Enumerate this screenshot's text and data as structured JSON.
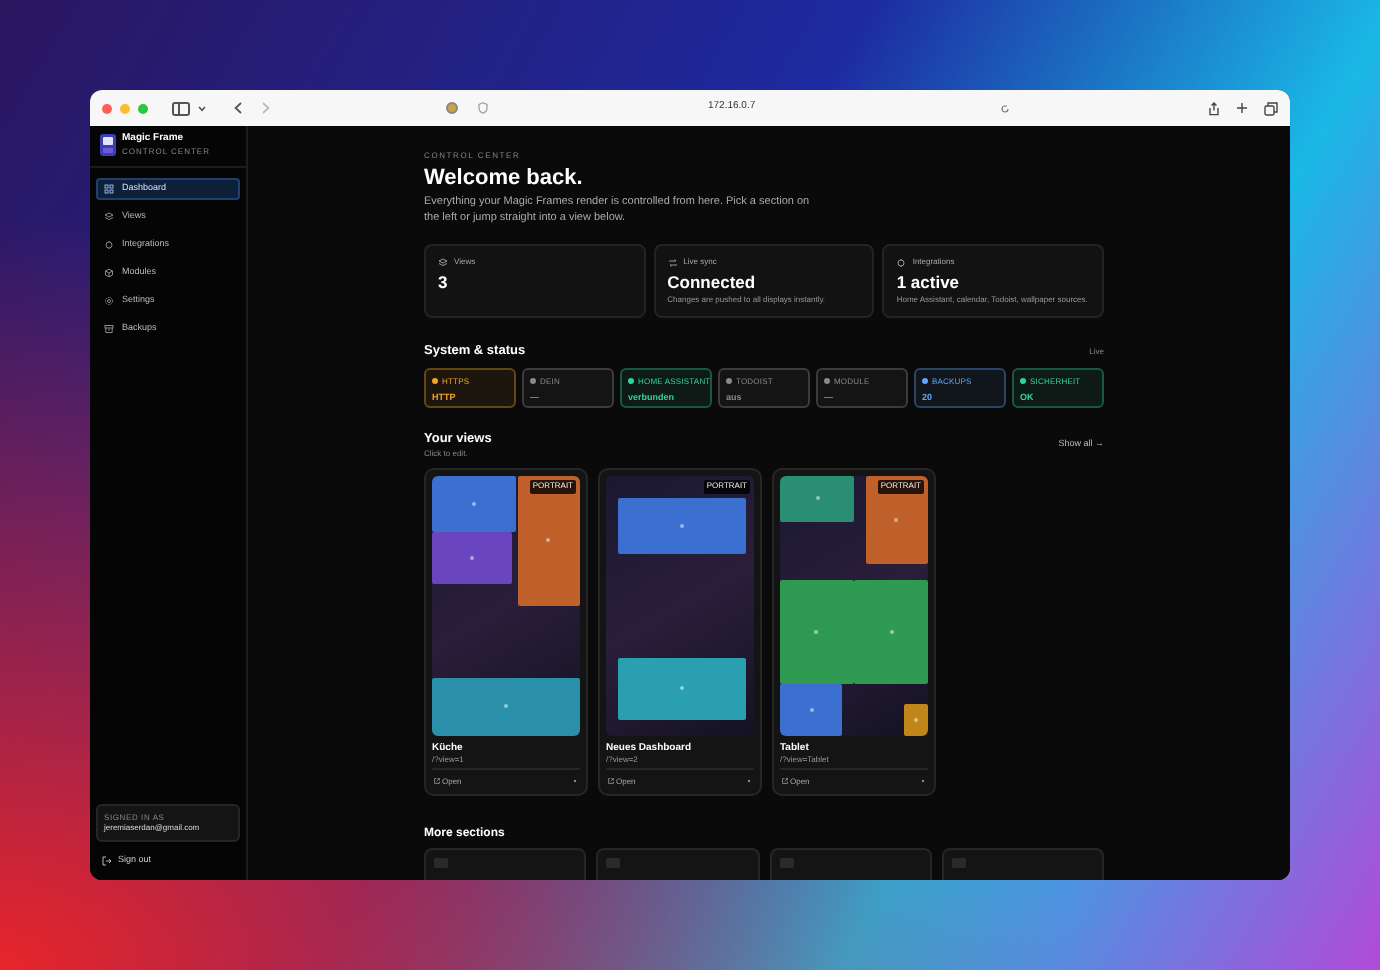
{
  "browser": {
    "url": "172.16.0.7"
  },
  "sidebar": {
    "app_title": "Magic Frame",
    "app_subtitle": "CONTROL CENTER",
    "nav": [
      {
        "label": "Dashboard",
        "selected": true,
        "kind": "grid"
      },
      {
        "label": "Views",
        "selected": false,
        "kind": "layers"
      },
      {
        "label": "Integrations",
        "selected": false,
        "kind": "plug"
      },
      {
        "label": "Modules",
        "selected": false,
        "kind": "box"
      },
      {
        "label": "Settings",
        "selected": false,
        "kind": "gear"
      },
      {
        "label": "Backups",
        "selected": false,
        "kind": "archive"
      }
    ],
    "signed_in_label": "SIGNED IN AS",
    "email": "jeremiaserdan@gmail.com",
    "sign_out": "Sign out"
  },
  "header": {
    "eyebrow": "CONTROL CENTER",
    "title": "Welcome back.",
    "description": "Everything your Magic Frames render is controlled from here. Pick a section on the left or jump straight into a view below."
  },
  "stats": [
    {
      "label": "Views",
      "value": "3",
      "kind": "layers"
    },
    {
      "label": "Live sync",
      "value": "Connected",
      "note": "Changes are pushed to all displays instantly.",
      "kind": "sync"
    },
    {
      "label": "Integrations",
      "value": "1 active",
      "note": "Home Assistant, calendar, Todoist, wallpaper sources.",
      "kind": "plug"
    }
  ],
  "status": {
    "title": "System & status",
    "live": "Live",
    "chips": [
      {
        "label": "HTTPS",
        "value": "HTTP",
        "color": "#f5a524"
      },
      {
        "label": "DEIN",
        "value": "—",
        "color": "#8a8a8a"
      },
      {
        "label": "HOME ASSISTANT",
        "value": "verbunden",
        "color": "#34d399"
      },
      {
        "label": "TODOIST",
        "value": "aus",
        "color": "#8a8a8a"
      },
      {
        "label": "MODULE",
        "value": "—",
        "color": "#8a8a8a"
      },
      {
        "label": "BACKUPS",
        "value": "20",
        "color": "#60a5fa"
      },
      {
        "label": "SICHERHEIT",
        "value": "OK",
        "color": "#34d399"
      }
    ]
  },
  "views": {
    "title": "Your views",
    "subtitle": "Click to edit.",
    "show_all": "Show all →",
    "cards": [
      {
        "name": "Küche",
        "path": "/?view=1",
        "badge": "PORTRAIT",
        "open": "Open",
        "tiles": [
          {
            "color": "#3b6fd0"
          },
          {
            "color": "#6a45c0"
          },
          {
            "color": "#c0602a"
          },
          {
            "color": "#2a8fa8"
          }
        ]
      },
      {
        "name": "Neues Dashboard",
        "path": "/?view=2",
        "badge": "PORTRAIT",
        "open": "Open",
        "tiles": [
          {
            "color": "#3b6fd0"
          },
          {
            "color": "#2a9fb0"
          }
        ]
      },
      {
        "name": "Tablet",
        "path": "/?view=Tablet",
        "badge": "PORTRAIT",
        "open": "Open",
        "tiles": [
          {
            "color": "#2a8f72"
          },
          {
            "color": "#c0602a"
          },
          {
            "color": "#2f9a52"
          },
          {
            "color": "#2f9a52"
          },
          {
            "color": "#3b6fd0"
          },
          {
            "color": "#c0861a"
          }
        ]
      }
    ]
  },
  "more_sections": {
    "title": "More sections"
  }
}
